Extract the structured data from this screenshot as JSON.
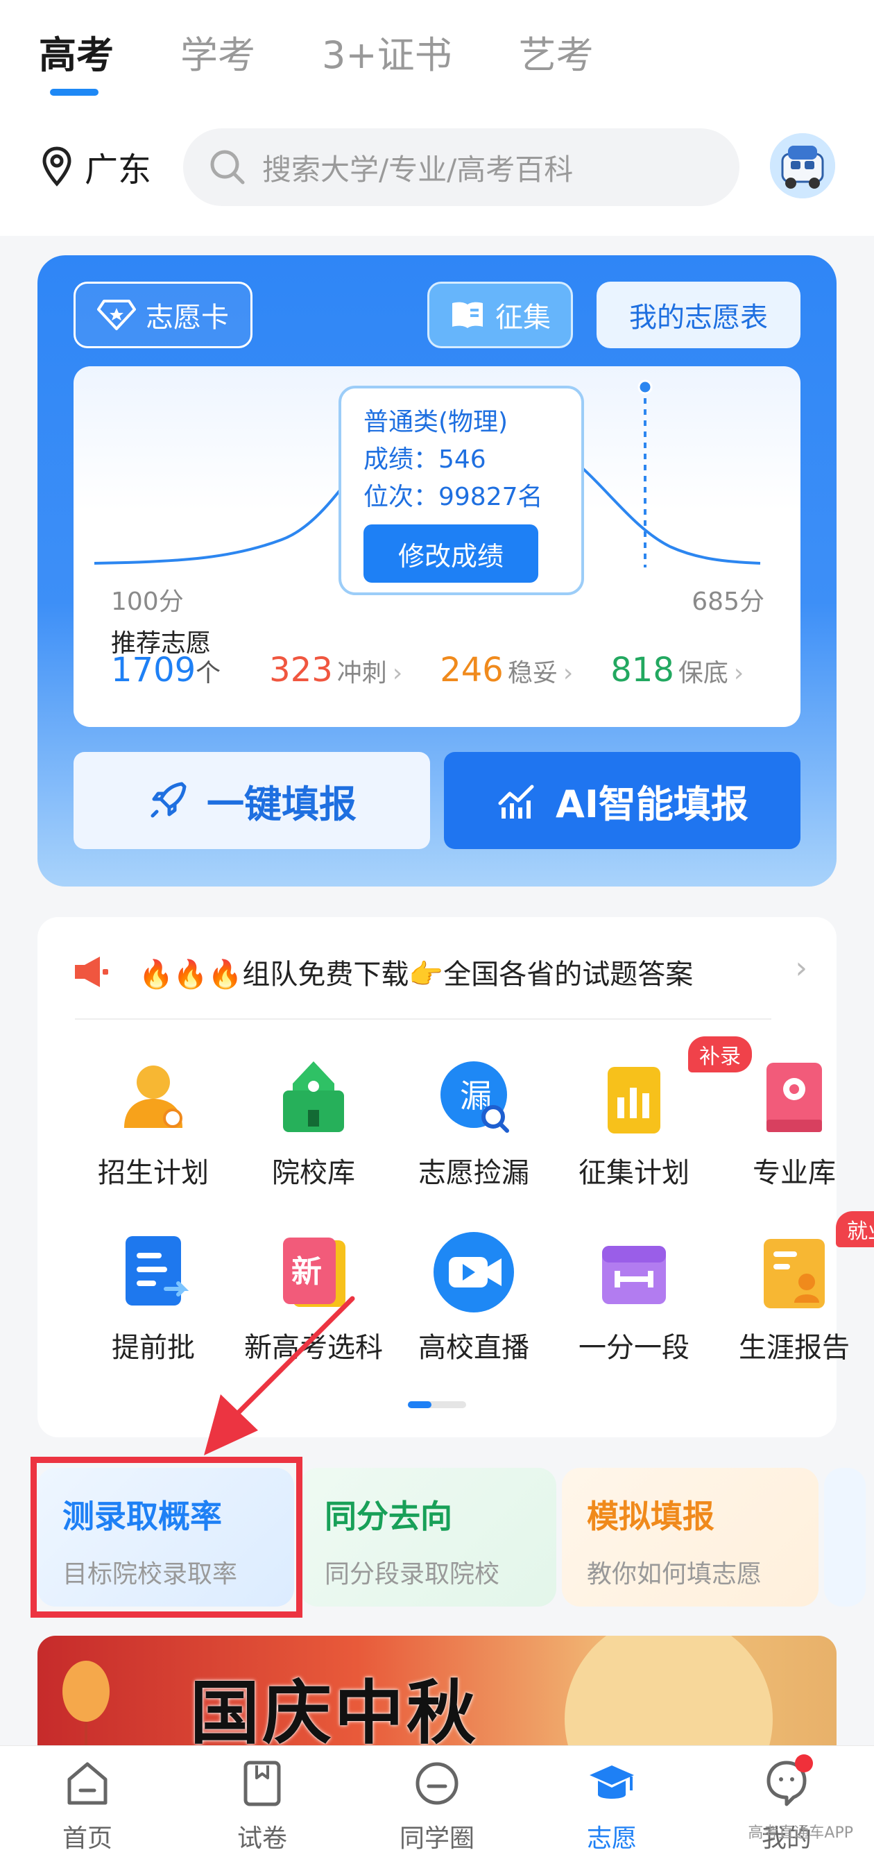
{
  "header": {
    "tabs": [
      {
        "label": "高考",
        "active": true
      },
      {
        "label": "学考",
        "active": false
      },
      {
        "label": "3+证书",
        "active": false
      },
      {
        "label": "艺考",
        "active": false
      }
    ],
    "location": "广东",
    "search_placeholder": "搜索大学/专业/高考百科"
  },
  "volunteer_card": {
    "chip_card": "志愿卡",
    "chip_collect": "征集",
    "chip_my_table": "我的志愿表",
    "tooltip": {
      "category": "普通类(物理)",
      "score_line": "成绩：546",
      "rank_line": "位次：99827名",
      "edit_button": "修改成绩"
    },
    "axis_min": "100分",
    "axis_max": "685分",
    "recommend_label": "推荐志愿",
    "recommend_total": "1709",
    "recommend_unit": "个",
    "rush_count": "323",
    "rush_label": "冲刺",
    "safe_count": "246",
    "safe_label": "稳妥",
    "guarantee_count": "818",
    "guarantee_label": "保底",
    "btn_one_click": "一键填报",
    "btn_ai": "AI智能填报",
    "colors": {
      "rush": "#f0563f",
      "safe": "#f08a1c",
      "guarantee": "#22a860"
    }
  },
  "features": {
    "notice": "🔥🔥🔥组队免费下载👉全国各省的试题答案",
    "items": [
      {
        "label": "招生计划",
        "icon": "admission-plan-icon"
      },
      {
        "label": "院校库",
        "icon": "school-library-icon"
      },
      {
        "label": "志愿捡漏",
        "icon": "volunteer-pickup-icon",
        "glyph": "漏"
      },
      {
        "label": "征集计划",
        "icon": "collection-plan-icon",
        "badge": "补录"
      },
      {
        "label": "专业库",
        "icon": "major-library-icon"
      },
      {
        "label": "提前批",
        "icon": "early-batch-icon"
      },
      {
        "label": "新高考选科",
        "icon": "new-gaokao-subject-icon",
        "glyph": "新"
      },
      {
        "label": "高校直播",
        "icon": "university-live-icon"
      },
      {
        "label": "一分一段",
        "icon": "score-segment-icon"
      },
      {
        "label": "生涯报告",
        "icon": "career-report-icon",
        "badge": "就业"
      }
    ]
  },
  "quick_cards": [
    {
      "title": "测录取概率",
      "subtitle": "目标院校录取率"
    },
    {
      "title": "同分去向",
      "subtitle": "同分段录取院校"
    },
    {
      "title": "模拟填报",
      "subtitle": "教你如何填志愿"
    }
  ],
  "banner": {
    "title": "国庆中秋"
  },
  "bottom_nav": [
    {
      "label": "首页",
      "icon": "home-icon"
    },
    {
      "label": "试卷",
      "icon": "exam-paper-icon"
    },
    {
      "label": "同学圈",
      "icon": "classmates-icon"
    },
    {
      "label": "志愿",
      "icon": "graduation-cap-icon",
      "active": true
    },
    {
      "label": "我的",
      "icon": "profile-icon",
      "has_dot": true
    }
  ],
  "watermark": "高考直通车APP"
}
